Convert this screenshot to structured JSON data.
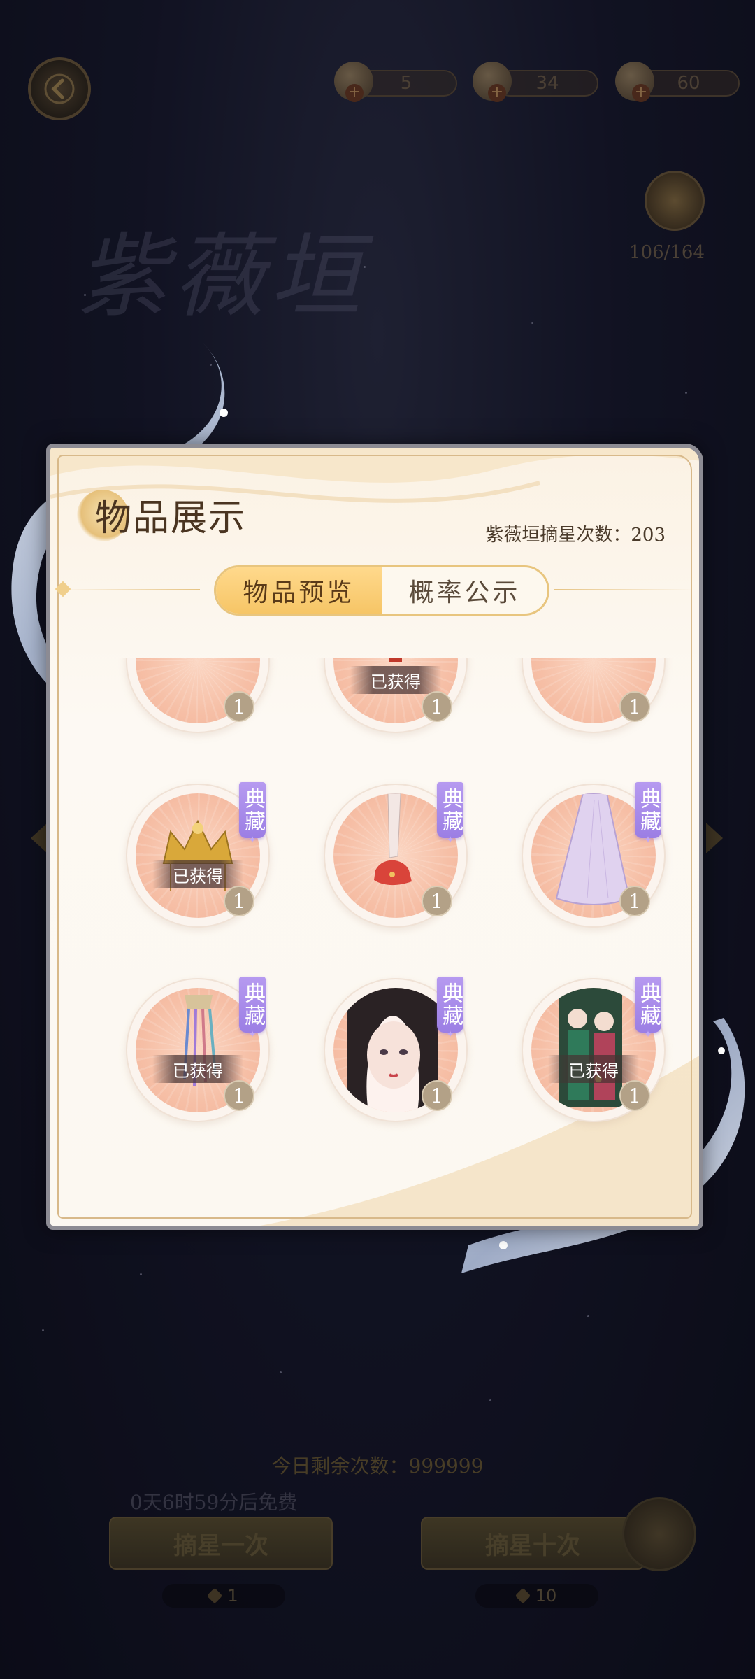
{
  "header": {
    "title": "紫薇垣",
    "currencies": [
      {
        "icon": "stardust-icon",
        "amount": "5"
      },
      {
        "icon": "coin-stack-icon",
        "amount": "34"
      },
      {
        "icon": "pearl-icon",
        "amount": "60"
      }
    ],
    "progress": "106/164"
  },
  "modal": {
    "title": "物品展示",
    "draw_count_label": "紫薇垣摘星次数：203",
    "tabs": [
      {
        "label": "物品预览",
        "active": true
      },
      {
        "label": "概率公示",
        "active": false
      }
    ],
    "items": [
      {
        "art": "partial-item-icon",
        "tag": "",
        "owned": "",
        "qty": "1"
      },
      {
        "art": "tassel-ornament-icon",
        "tag": "",
        "owned": "已获得",
        "qty": "1"
      },
      {
        "art": "red-garment-icon",
        "tag": "",
        "owned": "",
        "qty": "1"
      },
      {
        "art": "golden-crown-icon",
        "tag": "典藏",
        "owned": "已获得",
        "qty": "1"
      },
      {
        "art": "red-shoe-icon",
        "tag": "典藏",
        "owned": "",
        "qty": "1"
      },
      {
        "art": "lavender-skirt-icon",
        "tag": "典藏",
        "owned": "",
        "qty": "1"
      },
      {
        "art": "hair-ribbon-icon",
        "tag": "典藏",
        "owned": "已获得",
        "qty": "1"
      },
      {
        "art": "makeup-portrait-icon",
        "tag": "典藏",
        "owned": "",
        "qty": "1"
      },
      {
        "art": "couple-card-icon",
        "tag": "典藏",
        "owned": "已获得",
        "qty": "1"
      }
    ]
  },
  "footer": {
    "remaining": "今日剩余次数：999999",
    "free_timer": "0天6时59分后免费",
    "draw_once": "摘星一次",
    "draw_ten": "摘星十次",
    "cost_once": "1",
    "cost_ten": "10"
  },
  "colors": {
    "accent": "#f6c566",
    "tag": "#9b7ee4",
    "qty": "#b3a187"
  }
}
